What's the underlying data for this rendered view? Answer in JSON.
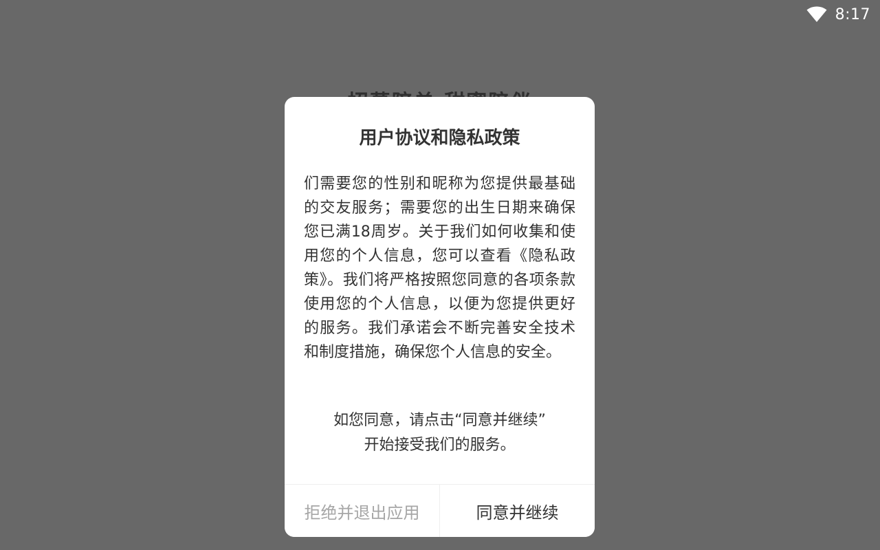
{
  "status_bar": {
    "time": "8:17",
    "wifi_icon": "wifi-icon"
  },
  "background": {
    "title": "招募陪单 甜蜜陪伴"
  },
  "dialog": {
    "title": "用户协议和隐私政策",
    "body": "们需要您的性别和昵称为您提供最基础的交友服务；需要您的出生日期来确保您已满18周岁。关于我们如何收集和使用您的个人信息，您可以查看《隐私政策》。我们将严格按照您同意的各项条款使用您的个人信息，以便为您提供更好的服务。我们承诺会不断完善安全技术和制度措施，确保您个人信息的安全。",
    "prompt_line1": "如您同意，请点击“同意并继续”",
    "prompt_line2": "开始接受我们的服务。",
    "reject_label": "拒绝并退出应用",
    "accept_label": "同意并继续"
  },
  "colors": {
    "overlay": "#686868",
    "dialog_bg": "#ffffff",
    "text_primary": "#333333",
    "text_disabled": "#a6a6a6"
  }
}
